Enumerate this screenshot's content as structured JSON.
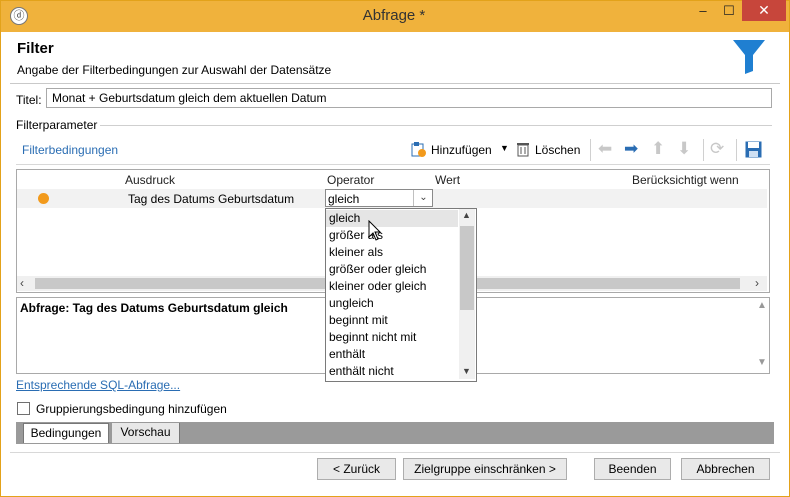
{
  "window": {
    "title": "Abfrage *",
    "minimize": "–",
    "maximize": "☐",
    "close": "✕",
    "app_icon": "ⓓ"
  },
  "header": {
    "title": "Filter",
    "subtitle": "Angabe der Filterbedingungen zur Auswahl der Datensätze",
    "icon": "funnel-icon",
    "icon_color": "#1f7fd1"
  },
  "title_field": {
    "label": "Titel:",
    "value": "Monat + Geburtsdatum gleich dem aktuellen Datum"
  },
  "filter_group": {
    "label": "Filterparameter"
  },
  "toolbar": {
    "section_label": "Filterbedingungen",
    "add_label": "Hinzufügen",
    "add_caret": "▼",
    "delete_label": "Löschen"
  },
  "grid": {
    "columns": [
      "Ausdruck",
      "Operator",
      "Wert",
      "Berücksichtigt wenn"
    ],
    "row": {
      "expression": "Tag des Datums Geburtsdatum",
      "operator": "gleich",
      "status_color": "#f29a1c"
    }
  },
  "query_text": "Abfrage: Tag des Datums Geburtsdatum gleich",
  "operator_options": [
    "gleich",
    "größer als",
    "kleiner als",
    "größer oder gleich",
    "kleiner oder gleich",
    "ungleich",
    "beginnt mit",
    "beginnt nicht mit",
    "enthält",
    "enthält nicht"
  ],
  "sql_link": "Entsprechende SQL-Abfrage...",
  "group_checkbox": {
    "label": "Gruppierungsbedingung hinzufügen",
    "checked": false
  },
  "tabs": [
    "Bedingungen",
    "Vorschau"
  ],
  "buttons": {
    "back": "< Zurück",
    "next": "Zielgruppe einschränken >",
    "end": "Beenden",
    "cancel": "Abbrechen"
  }
}
